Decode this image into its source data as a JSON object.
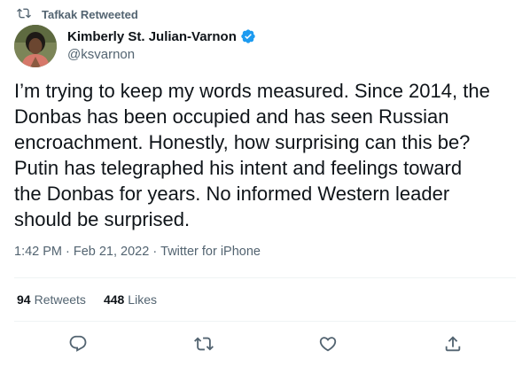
{
  "retweet_header": {
    "text": "Tafkak Retweeted",
    "icon": "retweet-icon"
  },
  "author": {
    "name": "Kimberly St. Julian-Varnon",
    "handle": "@ksvarnon",
    "verified_icon": "verified-badge-icon"
  },
  "tweet": {
    "lines": [
      "I’m trying to keep my words measured. Since 2014, the",
      "Donbas has been occupied and has seen Russian",
      "encroachment. Honestly, how surprising can this be?",
      "Putin has telegraphed his intent and feelings toward",
      "the Donbas for years. No informed Western leader",
      "should be surprised."
    ]
  },
  "meta": {
    "time": "1:42 PM",
    "sep1": "·",
    "date": "Feb 21, 2022",
    "sep2": "·",
    "source": "Twitter for iPhone"
  },
  "stats": {
    "retweets_count": "94",
    "retweets_label": "Retweets",
    "likes_count": "448",
    "likes_label": "Likes"
  },
  "actions": [
    "reply-icon",
    "retweet-icon",
    "like-icon",
    "share-icon"
  ],
  "colors": {
    "text": "#0f1419",
    "secondary": "#536471",
    "verified": "#1d9bf0",
    "divider": "#eff3f4"
  }
}
